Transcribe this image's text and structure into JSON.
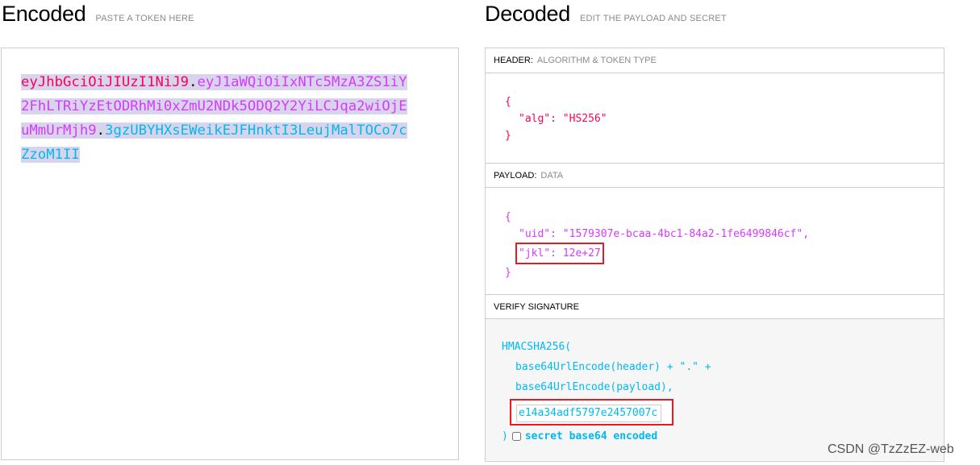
{
  "encoded": {
    "title": "Encoded",
    "subtitle": "PASTE A TOKEN HERE",
    "token_header": "eyJhbGciOiJIUzI1NiJ9",
    "token_dot1": ".",
    "token_payload": "eyJ1aWQiOiIxNTc5MzA3ZS1iY2FhLTRiYzEtODRhMi0xZmU2NDk5ODQ2Y2YiLCJqa2wiOjEuMmUrMjh9",
    "token_dot2": ".",
    "token_signature": "3gzUBYHXsEWeikEJFHnktI3LeujMalTOCo7cZzoM1II"
  },
  "decoded": {
    "title": "Decoded",
    "subtitle": "EDIT THE PAYLOAD AND SECRET",
    "header_section": {
      "label": "HEADER:",
      "sublabel": "ALGORITHM & TOKEN TYPE",
      "open_brace": "{",
      "alg_line": "\"alg\": \"HS256\"",
      "close_brace": "}"
    },
    "payload_section": {
      "label": "PAYLOAD:",
      "sublabel": "DATA",
      "open_brace": "{",
      "uid_line": "\"uid\": \"1579307e-bcaa-4bc1-84a2-1fe6499846cf\",",
      "jkl_line": "\"jkl\": 12e+27",
      "close_brace": "}"
    },
    "verify_section": {
      "label": "VERIFY SIGNATURE",
      "line1": "HMACSHA256(",
      "line2": "base64UrlEncode(header) + \".\" +",
      "line3": "base64UrlEncode(payload),",
      "secret_value": "e14a34adf5797e2457007c",
      "close_paren": ")",
      "secret_checkbox_label": "secret base64 encoded",
      "secret_checkbox_checked": false
    }
  },
  "watermark": "CSDN @TzZzEZ-web"
}
